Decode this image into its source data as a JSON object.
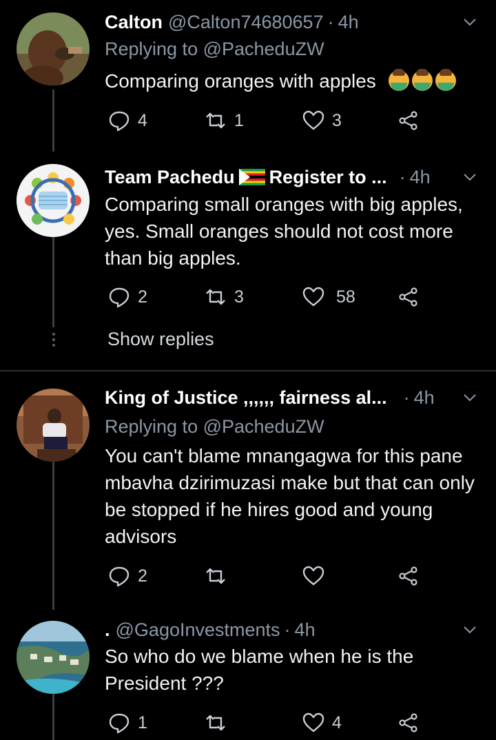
{
  "tweets": [
    {
      "name": "Calton",
      "handle": "@Calton74680657",
      "time": "4h",
      "replying_to": "Replying to @PacheduZW",
      "text": "Comparing oranges with apples",
      "emoji": "🙆‍♂️🙆‍♂️🙆‍♂️",
      "replies": "4",
      "retweets": "1",
      "likes": "3"
    },
    {
      "name": "Team Pachedu",
      "name_suffix": "Register to ...",
      "handle": "",
      "time": "4h",
      "text": "Comparing small oranges with big apples, yes. Small oranges should not cost more than big apples.",
      "replies": "2",
      "retweets": "3",
      "likes": "58"
    },
    {
      "name": "King of Justice ,,,,,, fairness al...",
      "handle": "",
      "time": "4h",
      "replying_to": "Replying to @PacheduZW",
      "text": "You can't blame mnangagwa for this pane mbavha dzirimuzasi make but that can only be stopped if he hires good and young advisors",
      "replies": "2",
      "retweets": "",
      "likes": ""
    },
    {
      "name": ".",
      "handle": "@GagoInvestments",
      "time": "4h",
      "text": "So who do we blame when he is the President ???",
      "replies": "1",
      "retweets": "",
      "likes": "4"
    }
  ],
  "show_replies_label": "Show replies",
  "dot_separator": "·",
  "colors": {
    "background": "#000000",
    "secondary_text": "#8b98a5",
    "divider": "#2a2f33"
  },
  "icons": [
    "reply-icon",
    "retweet-icon",
    "like-icon",
    "share-icon",
    "chevron-down-icon",
    "more-dots-icon"
  ]
}
